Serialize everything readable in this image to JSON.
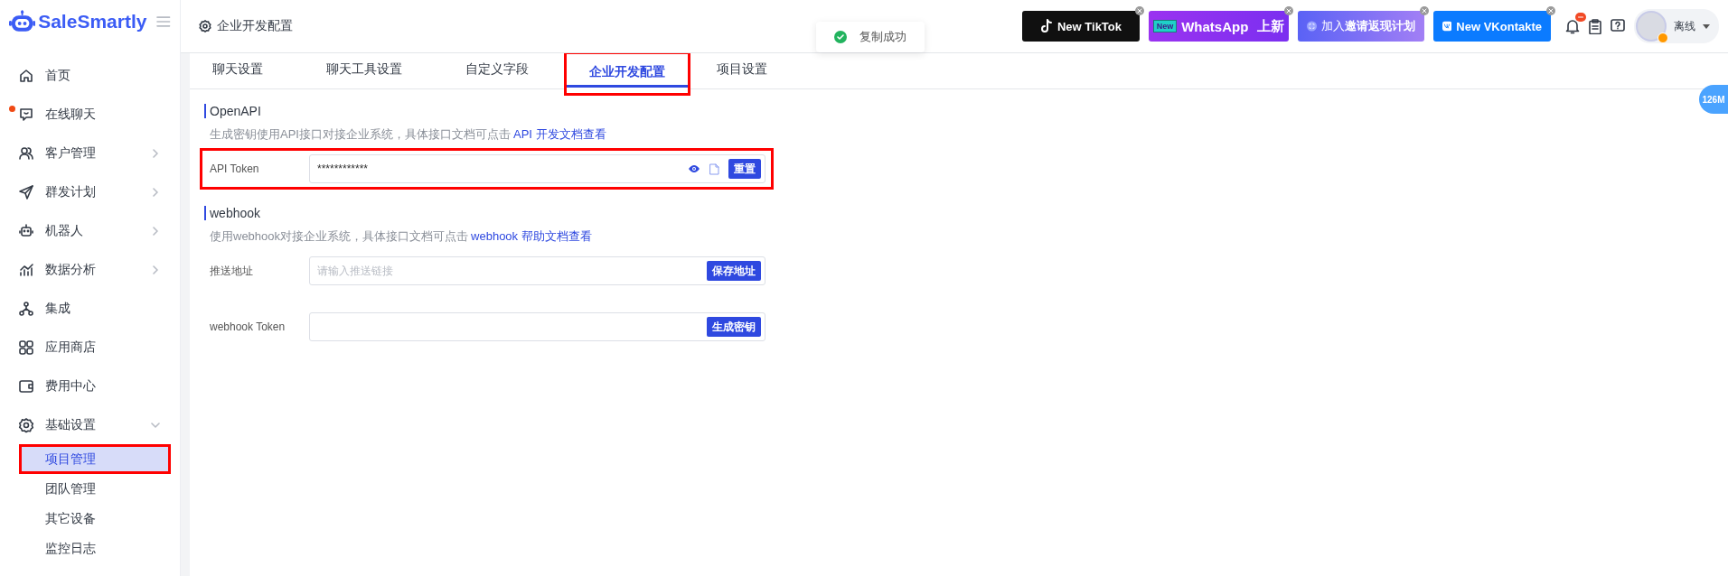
{
  "logo": "SaleSmartly",
  "sidebar": {
    "items": [
      {
        "label": "首页",
        "arrow": false,
        "unread": false
      },
      {
        "label": "在线聊天",
        "arrow": false,
        "unread": true
      },
      {
        "label": "客户管理",
        "arrow": true,
        "expanded": false,
        "unread": false
      },
      {
        "label": "群发计划",
        "arrow": true,
        "expanded": false,
        "unread": false
      },
      {
        "label": "机器人",
        "arrow": true,
        "expanded": false,
        "unread": false
      },
      {
        "label": "数据分析",
        "arrow": true,
        "expanded": false,
        "unread": false
      },
      {
        "label": "集成",
        "arrow": false,
        "unread": false
      },
      {
        "label": "应用商店",
        "arrow": false,
        "unread": false
      },
      {
        "label": "费用中心",
        "arrow": false,
        "unread": false
      },
      {
        "label": "基础设置",
        "arrow": true,
        "expanded": true,
        "unread": false,
        "children": [
          {
            "label": "项目管理",
            "selected": true,
            "highlighted": true
          },
          {
            "label": "团队管理",
            "selected": false,
            "highlighted": false
          },
          {
            "label": "其它设备",
            "selected": false,
            "highlighted": false
          },
          {
            "label": "监控日志",
            "selected": false,
            "highlighted": false
          }
        ]
      }
    ]
  },
  "header": {
    "breadcrumb": "企业开发配置",
    "toast": "复制成功",
    "banners": [
      {
        "kind": "tiktok",
        "text": "New TikTok"
      },
      {
        "kind": "whatsapp",
        "badge": "New",
        "text": "WhatsApp",
        "suffix": "上新"
      },
      {
        "kind": "invite",
        "text": "加入**邀请返现计划**"
      },
      {
        "kind": "vk",
        "text": "New VKontakte"
      }
    ],
    "user_status": "离线"
  },
  "memory_badge": "126M",
  "tabs": [
    {
      "label": "聊天设置",
      "selected": false,
      "highlighted": false
    },
    {
      "label": "聊天工具设置",
      "selected": false,
      "highlighted": false
    },
    {
      "label": "自定义字段",
      "selected": false,
      "highlighted": false
    },
    {
      "label": "企业开发配置",
      "selected": true,
      "highlighted": true
    },
    {
      "label": "项目设置",
      "selected": false,
      "highlighted": false
    }
  ],
  "sections": [
    {
      "title": "OpenAPI",
      "description": "生成密钥使用API接口对接企业系统，具体接口文档可点击",
      "link": "API 开发文档查看",
      "rows": [
        {
          "kind": "token",
          "label": "API Token",
          "value": "************",
          "button": "重置",
          "highlighted": true
        }
      ]
    },
    {
      "title": "webhook",
      "description": "使用webhook对接企业系统，具体接口文档可点击",
      "link": "webhook 帮助文档查看",
      "rows": [
        {
          "kind": "input",
          "label": "推送地址",
          "placeholder": "请输入推送链接",
          "button": "保存地址",
          "highlighted": false
        },
        {
          "kind": "input",
          "label": "webhook Token",
          "button": "生成密钥",
          "highlighted": false
        }
      ]
    }
  ]
}
